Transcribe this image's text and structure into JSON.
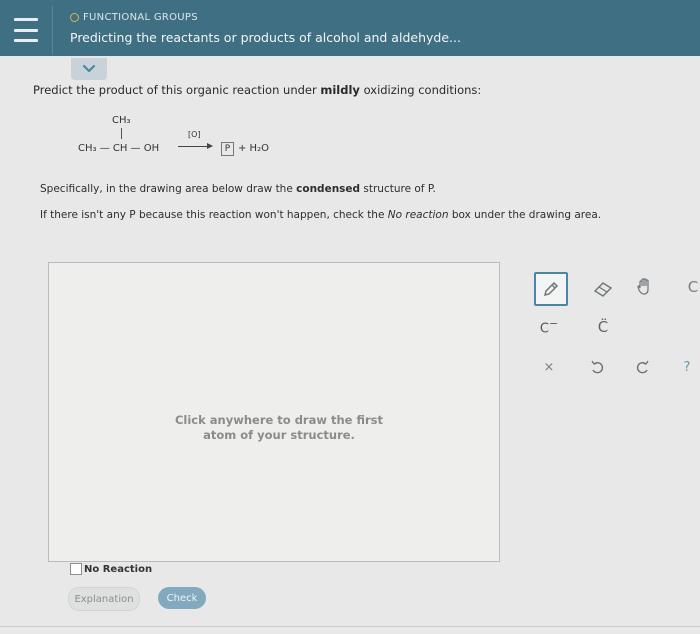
{
  "header": {
    "topic": "FUNCTIONAL GROUPS",
    "title": "Predicting the reactants or products of alcohol and aldehyde..."
  },
  "question": {
    "prompt_pre": "Predict the product of this organic reaction under ",
    "prompt_bold": "mildly",
    "prompt_post": " oxidizing conditions:",
    "reaction": {
      "top_group": "CH₃",
      "chain": "CH₃ — CH — OH",
      "oxidant": "[O]",
      "product_box": "P",
      "products_rest": "+ H₂O"
    },
    "spec1_pre": "Specifically, in the drawing area below draw the ",
    "spec1_bold": "condensed",
    "spec1_post": " structure of P.",
    "spec2_pre": "If there isn't any P because this reaction won't happen, check the ",
    "spec2_italic": "No reaction",
    "spec2_post": " box under the drawing area."
  },
  "drawing": {
    "hint_line1": "Click anywhere to draw the first",
    "hint_line2": "atom of your structure."
  },
  "toolbar": {
    "carbanion": "C",
    "carbanion_sup": "−",
    "carbon_lone": "C̈",
    "clear": "×",
    "help": "?",
    "cut_off": "C"
  },
  "footer": {
    "no_reaction_label": "No Reaction",
    "explanation_label": "Explanation",
    "check_label": "Check"
  },
  "colors": {
    "header": "#3f6f82",
    "check_button": "#83a9bf",
    "accent": "#4b86a3"
  }
}
